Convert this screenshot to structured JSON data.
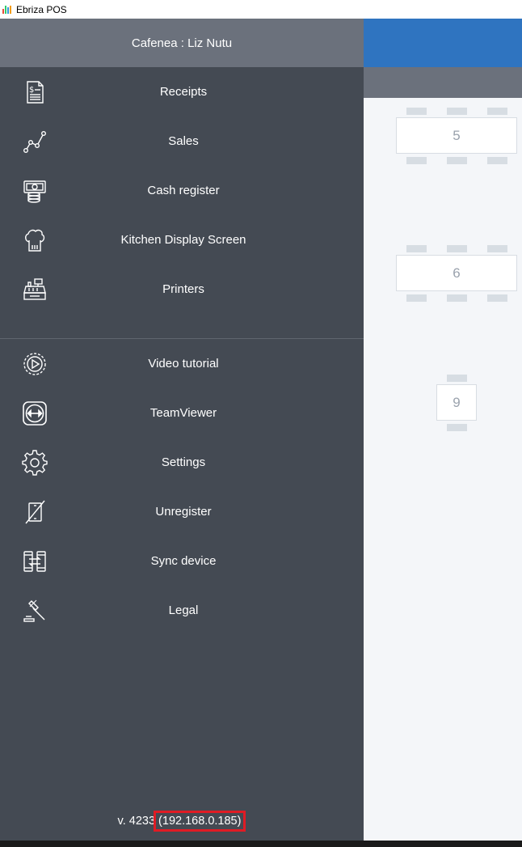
{
  "window": {
    "title": "Ebriza POS"
  },
  "drawer": {
    "header": "Cafenea : Liz Nutu",
    "primary_items": [
      {
        "label": "Receipts",
        "icon": "receipt-icon"
      },
      {
        "label": "Sales",
        "icon": "line-chart-icon"
      },
      {
        "label": "Cash register",
        "icon": "cash-register-icon"
      },
      {
        "label": "Kitchen Display Screen",
        "icon": "chef-hat-icon"
      },
      {
        "label": "Printers",
        "icon": "printer-icon"
      }
    ],
    "secondary_items": [
      {
        "label": "Video tutorial",
        "icon": "play-circle-icon"
      },
      {
        "label": "TeamViewer",
        "icon": "teamviewer-icon"
      },
      {
        "label": "Settings",
        "icon": "gear-icon"
      },
      {
        "label": "Unregister",
        "icon": "unregister-device-icon"
      },
      {
        "label": "Sync device",
        "icon": "sync-device-icon"
      },
      {
        "label": "Legal",
        "icon": "gavel-icon"
      }
    ],
    "version_prefix": "v. 4233",
    "ip_address": "(192.168.0.185)"
  },
  "floor_plan": {
    "tables": [
      {
        "number": "5"
      },
      {
        "number": "6"
      },
      {
        "number": "9"
      }
    ]
  },
  "colors": {
    "drawer_bg": "#444a53",
    "drawer_header_bg": "#6b717c",
    "accent_blue": "#2f74c0",
    "highlight_red": "#e01b24"
  }
}
